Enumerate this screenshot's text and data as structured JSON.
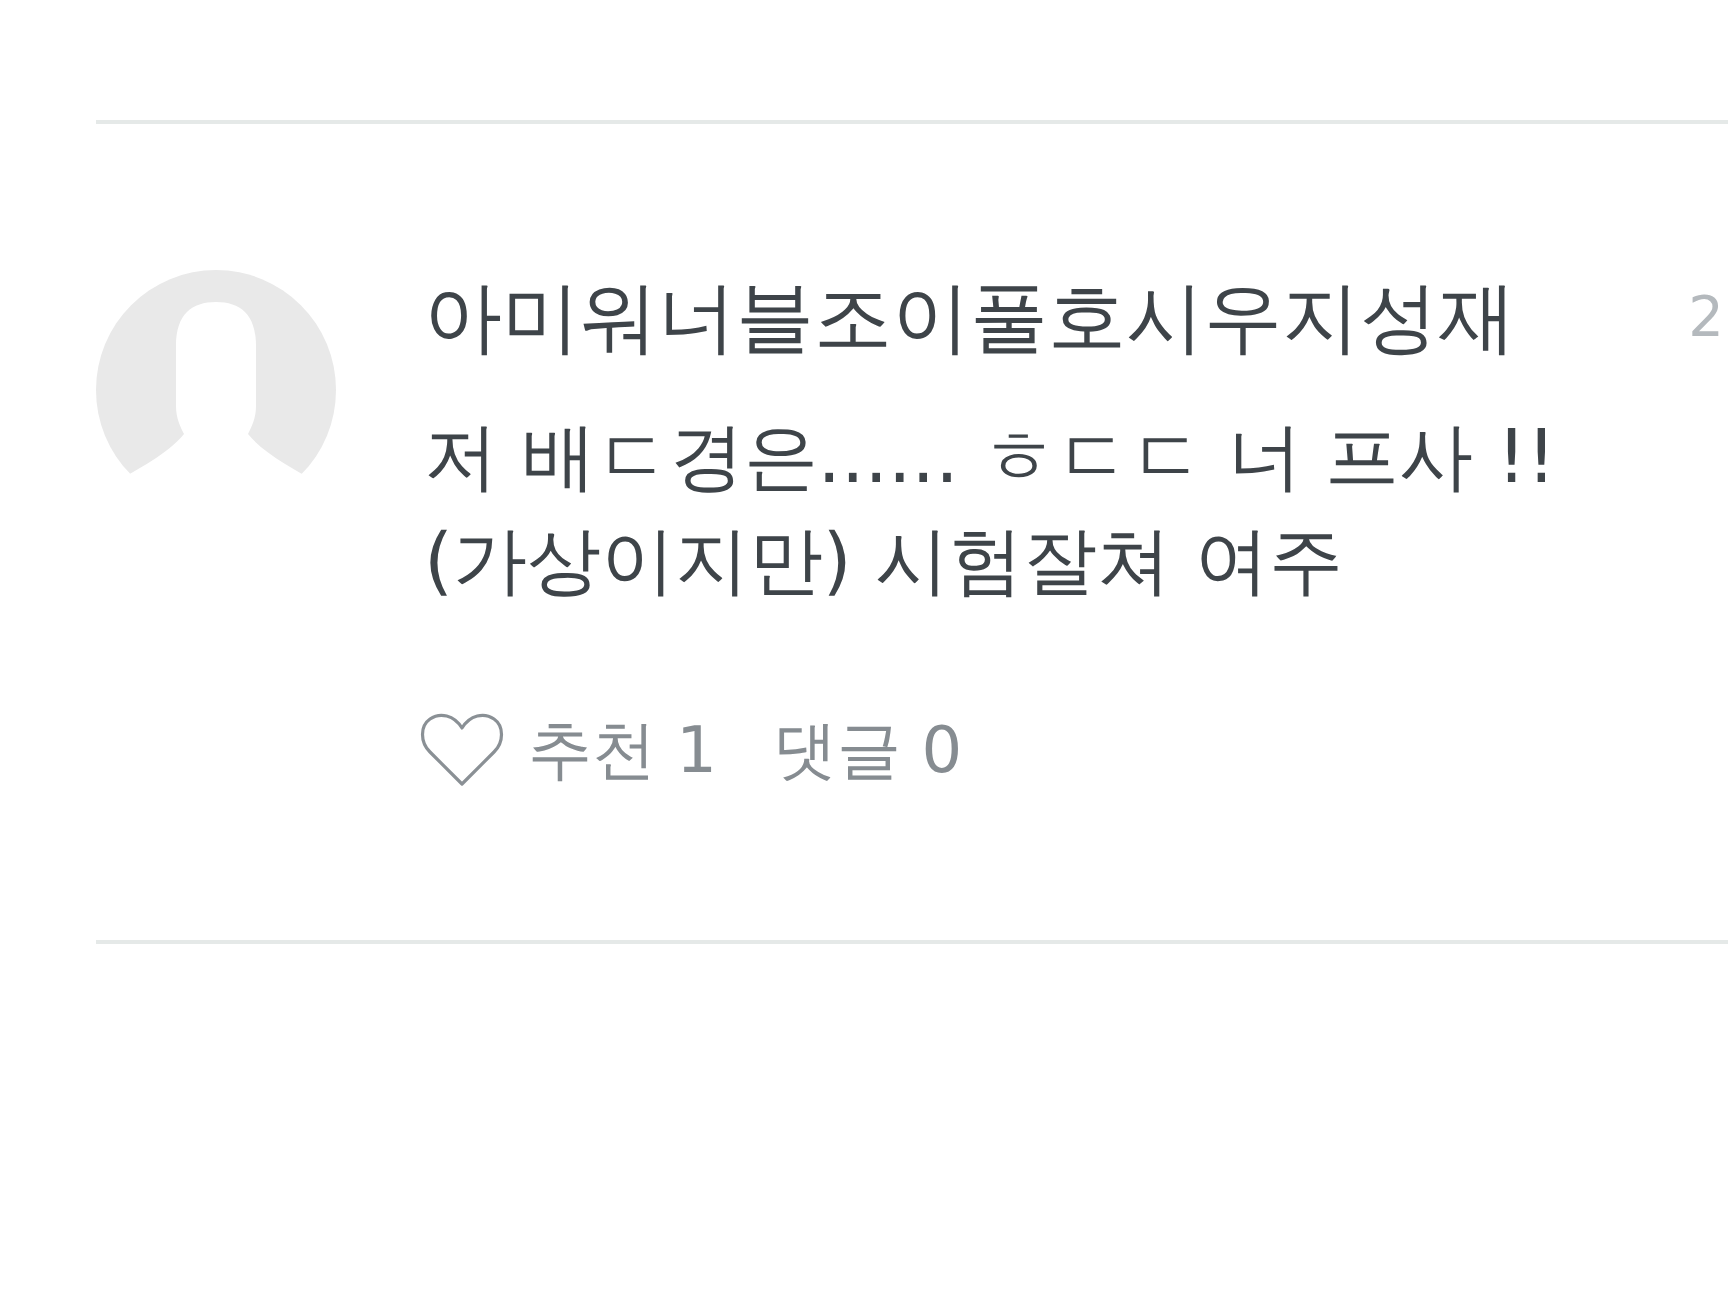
{
  "comment": {
    "author": "아미워너블조이풀호시우지성재",
    "date": "2",
    "text": "저 배ㄷ경은...... ㅎㄷㄷ 너 프사 !!\n(가상이지만) 시험잘쳐 여주",
    "liked": false,
    "recommend_label": "추천 1",
    "reply_label": "댓글 0"
  }
}
